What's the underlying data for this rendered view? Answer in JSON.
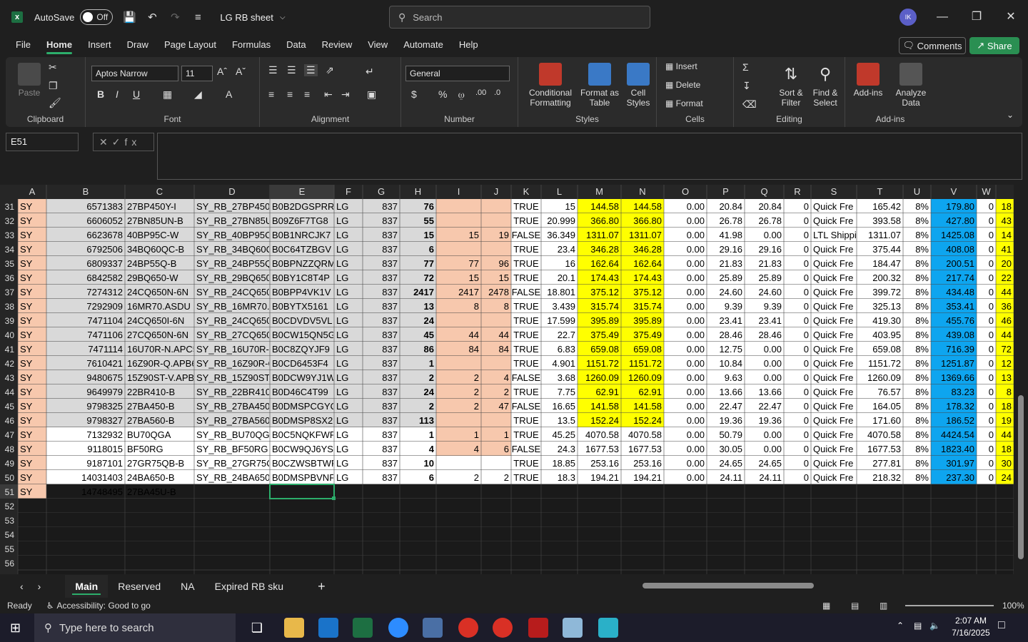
{
  "titlebar": {
    "autosave_label": "AutoSave",
    "autosave_state": "Off",
    "doc_title": "LG RB sheet",
    "search_placeholder": "Search",
    "avatar_initials": "IK"
  },
  "menu": {
    "tabs": [
      "File",
      "Home",
      "Insert",
      "Draw",
      "Page Layout",
      "Formulas",
      "Data",
      "Review",
      "View",
      "Automate",
      "Help"
    ],
    "active": "Home",
    "comments": "Comments",
    "share": "Share"
  },
  "ribbon": {
    "clipboard": {
      "paste": "Paste",
      "label": "Clipboard"
    },
    "font": {
      "name": "Aptos Narrow",
      "size": "11",
      "label": "Font"
    },
    "alignment": {
      "label": "Alignment"
    },
    "number": {
      "format": "General",
      "label": "Number"
    },
    "styles": {
      "conditional": "Conditional Formatting",
      "format_table": "Format as Table",
      "cell_styles": "Cell Styles",
      "label": "Styles"
    },
    "cells": {
      "insert": "Insert",
      "delete": "Delete",
      "format": "Format",
      "label": "Cells"
    },
    "editing": {
      "sort": "Sort & Filter",
      "find": "Find & Select",
      "label": "Editing"
    },
    "addins": {
      "addins": "Add-ins",
      "analyze": "Analyze Data",
      "label": "Add-ins"
    }
  },
  "formula_bar": {
    "name_box": "E51",
    "formula": ""
  },
  "grid": {
    "columns": [
      "A",
      "B",
      "C",
      "D",
      "E",
      "F",
      "G",
      "H",
      "I",
      "J",
      "K",
      "L",
      "M",
      "N",
      "O",
      "P",
      "Q",
      "R",
      "S",
      "T",
      "U",
      "V",
      "W"
    ],
    "rows": [
      {
        "n": "31",
        "c": [
          "SY",
          "6571383",
          "27BP450Y-I",
          "SY_RB_27BP450Y-",
          "B0B2DGSPRR",
          "LG",
          "837",
          "76",
          "",
          "",
          "TRUE",
          "15",
          "144.58",
          "144.58",
          "0.00",
          "20.84",
          "20.84",
          "0",
          "Quick Fre",
          "165.42",
          "8%",
          "179.80",
          "0",
          "18"
        ]
      },
      {
        "n": "32",
        "c": [
          "SY",
          "6606052",
          "27BN85UN-B",
          "SY_RB_27BN85UN",
          "B09Z6F7TG8",
          "LG",
          "837",
          "55",
          "",
          "",
          "TRUE",
          "20.999",
          "366.80",
          "366.80",
          "0.00",
          "26.78",
          "26.78",
          "0",
          "Quick Fre",
          "393.58",
          "8%",
          "427.80",
          "0",
          "43"
        ]
      },
      {
        "n": "33",
        "c": [
          "SY",
          "6623678",
          "40BP95C-W",
          "SY_RB_40BP95C-W",
          "B0B1NRCJK7",
          "LG",
          "837",
          "15",
          "15",
          "19",
          "FALSE",
          "36.349",
          "1311.07",
          "1311.07",
          "0.00",
          "41.98",
          "0.00",
          "0",
          "LTL Shippi",
          "1311.07",
          "8%",
          "1425.08",
          "0",
          "14"
        ]
      },
      {
        "n": "34",
        "c": [
          "SY",
          "6792506",
          "34BQ60QC-B",
          "SY_RB_34BQ60QC",
          "B0C64TZBGV",
          "LG",
          "837",
          "6",
          "",
          "",
          "TRUE",
          "23.4",
          "346.28",
          "346.28",
          "0.00",
          "29.16",
          "29.16",
          "0",
          "Quick Fre",
          "375.44",
          "8%",
          "408.08",
          "0",
          "41"
        ]
      },
      {
        "n": "35",
        "c": [
          "SY",
          "6809337",
          "24BP55Q-B",
          "SY_RB_24BP55Q-",
          "B0BPNZZQRM",
          "LG",
          "837",
          "77",
          "77",
          "96",
          "TRUE",
          "16",
          "162.64",
          "162.64",
          "0.00",
          "21.83",
          "21.83",
          "0",
          "Quick Fre",
          "184.47",
          "8%",
          "200.51",
          "0",
          "20"
        ]
      },
      {
        "n": "36",
        "c": [
          "SY",
          "6842582",
          "29BQ650-W",
          "SY_RB_29BQ650-W",
          "B0BY1C8T4P",
          "LG",
          "837",
          "72",
          "15",
          "15",
          "TRUE",
          "20.1",
          "174.43",
          "174.43",
          "0.00",
          "25.89",
          "25.89",
          "0",
          "Quick Fre",
          "200.32",
          "8%",
          "217.74",
          "0",
          "22"
        ]
      },
      {
        "n": "37",
        "c": [
          "SY",
          "7274312",
          "24CQ650N-6N",
          "SY_RB_24CQ650N",
          "B0BPP4VK1V",
          "LG",
          "837",
          "2417",
          "2417",
          "2478",
          "FALSE",
          "18.801",
          "375.12",
          "375.12",
          "0.00",
          "24.60",
          "24.60",
          "0",
          "Quick Fre",
          "399.72",
          "8%",
          "434.48",
          "0",
          "44"
        ]
      },
      {
        "n": "38",
        "c": [
          "SY",
          "7292909",
          "16MR70.ASDU",
          "SY_RB_16MR70.A",
          "B0BYTX5161",
          "LG",
          "837",
          "13",
          "8",
          "8",
          "TRUE",
          "3.439",
          "315.74",
          "315.74",
          "0.00",
          "9.39",
          "9.39",
          "0",
          "Quick Fre",
          "325.13",
          "8%",
          "353.41",
          "0",
          "36"
        ]
      },
      {
        "n": "39",
        "c": [
          "SY",
          "7471104",
          "24CQ650I-6N",
          "SY_RB_24CQ650I-",
          "B0CDVDV5VL",
          "LG",
          "837",
          "24",
          "",
          "",
          "TRUE",
          "17.599",
          "395.89",
          "395.89",
          "0.00",
          "23.41",
          "23.41",
          "0",
          "Quick Fre",
          "419.30",
          "8%",
          "455.76",
          "0",
          "46"
        ]
      },
      {
        "n": "40",
        "c": [
          "SY",
          "7471106",
          "27CQ650N-6N",
          "SY_RB_27CQ650N",
          "B0CW15QN5G",
          "LG",
          "837",
          "45",
          "44",
          "44",
          "TRUE",
          "22.7",
          "375.49",
          "375.49",
          "0.00",
          "28.46",
          "28.46",
          "0",
          "Quick Fre",
          "403.95",
          "8%",
          "439.08",
          "0",
          "44"
        ]
      },
      {
        "n": "41",
        "c": [
          "SY",
          "7471114",
          "16U70R-N.APC5",
          "SY_RB_16U70R-N",
          "B0C8ZQYJF9",
          "LG",
          "837",
          "86",
          "84",
          "84",
          "TRUE",
          "6.83",
          "659.08",
          "659.08",
          "0.00",
          "12.75",
          "0.00",
          "0",
          "Quick Fre",
          "659.08",
          "8%",
          "716.39",
          "0",
          "72"
        ]
      },
      {
        "n": "42",
        "c": [
          "SY",
          "7610421",
          "16Z90R-Q.APB6",
          "SY_RB_16Z90R-Q",
          "B0CD6453F4",
          "LG",
          "837",
          "1",
          "",
          "",
          "TRUE",
          "4.901",
          "1151.72",
          "1151.72",
          "0.00",
          "10.84",
          "0.00",
          "0",
          "Quick Fre",
          "1151.72",
          "8%",
          "1251.87",
          "0",
          "12"
        ]
      },
      {
        "n": "43",
        "c": [
          "SY",
          "9480675",
          "15Z90ST-V.APB6",
          "SY_RB_15Z90ST-V",
          "B0DCW9YJ1W",
          "LG",
          "837",
          "2",
          "2",
          "4",
          "FALSE",
          "3.68",
          "1260.09",
          "1260.09",
          "0.00",
          "9.63",
          "0.00",
          "0",
          "Quick Fre",
          "1260.09",
          "8%",
          "1369.66",
          "0",
          "13"
        ]
      },
      {
        "n": "44",
        "c": [
          "SY",
          "9649979",
          "22BR410-B",
          "SY_RB_22BR410-B",
          "B0D46C4T99",
          "LG",
          "837",
          "24",
          "2",
          "2",
          "TRUE",
          "7.75",
          "62.91",
          "62.91",
          "0.00",
          "13.66",
          "13.66",
          "0",
          "Quick Fre",
          "76.57",
          "8%",
          "83.23",
          "0",
          "8"
        ]
      },
      {
        "n": "45",
        "c": [
          "SY",
          "9798325",
          "27BA450-B",
          "SY_RB_27BA450-B",
          "B0DMSPCGYQ",
          "LG",
          "837",
          "2",
          "2",
          "47",
          "FALSE",
          "16.65",
          "141.58",
          "141.58",
          "0.00",
          "22.47",
          "22.47",
          "0",
          "Quick Fre",
          "164.05",
          "8%",
          "178.32",
          "0",
          "18"
        ]
      },
      {
        "n": "46",
        "c": [
          "SY",
          "9798327",
          "27BA560-B",
          "SY_RB_27BA560-B",
          "B0DMSP8SX2",
          "LG",
          "837",
          "113",
          "",
          "",
          "TRUE",
          "13.5",
          "152.24",
          "152.24",
          "0.00",
          "19.36",
          "19.36",
          "0",
          "Quick Fre",
          "171.60",
          "8%",
          "186.52",
          "0",
          "19"
        ]
      },
      {
        "n": "47",
        "c": [
          "SY",
          "7132932",
          "BU70QGA",
          "SY_RB_BU70QGA",
          "B0C5NQKFWP",
          "LG",
          "837",
          "1",
          "1",
          "1",
          "TRUE",
          "45.25",
          "4070.58",
          "4070.58",
          "0.00",
          "50.79",
          "0.00",
          "0",
          "Quick Fre",
          "4070.58",
          "8%",
          "4424.54",
          "0",
          "44"
        ]
      },
      {
        "n": "48",
        "c": [
          "SY",
          "9118015",
          "BF50RG",
          "SY_RB_BF50RG",
          "B0CW9QJ6YS",
          "LG",
          "837",
          "4",
          "4",
          "6",
          "FALSE",
          "24.3",
          "1677.53",
          "1677.53",
          "0.00",
          "30.05",
          "0.00",
          "0",
          "Quick Fre",
          "1677.53",
          "8%",
          "1823.40",
          "0",
          "18"
        ]
      },
      {
        "n": "49",
        "c": [
          "SY",
          "9187101",
          "27GR75QB-B",
          "SY_RB_27GR75QB",
          "B0CZWSBTWR",
          "LG",
          "837",
          "10",
          "",
          "",
          "TRUE",
          "18.85",
          "253.16",
          "253.16",
          "0.00",
          "24.65",
          "24.65",
          "0",
          "Quick Fre",
          "277.81",
          "8%",
          "301.97",
          "0",
          "30"
        ]
      },
      {
        "n": "50",
        "c": [
          "SY",
          "14031403",
          "24BA650-B",
          "SY_RB_24BA650-B",
          "B0DMSPBVNF",
          "LG",
          "837",
          "6",
          "2",
          "2",
          "TRUE",
          "18.3",
          "194.21",
          "194.21",
          "0.00",
          "24.11",
          "24.11",
          "0",
          "Quick Fre",
          "218.32",
          "8%",
          "237.30",
          "0",
          "24"
        ]
      },
      {
        "n": "51",
        "c": [
          "SY",
          "14748495",
          "27BA45U-B",
          "",
          "",
          "",
          "",
          "",
          "",
          "",
          "",
          "",
          "",
          "",
          "",
          "",
          "",
          "",
          "",
          "",
          "",
          "",
          "",
          ""
        ]
      },
      {
        "n": "52",
        "c": []
      },
      {
        "n": "53",
        "c": []
      },
      {
        "n": "54",
        "c": []
      },
      {
        "n": "55",
        "c": []
      },
      {
        "n": "56",
        "c": []
      }
    ]
  },
  "sheets": {
    "tabs": [
      "Main",
      "Reserved",
      "NA",
      "Expired RB sku"
    ],
    "active": "Main"
  },
  "status": {
    "ready": "Ready",
    "accessibility": "Accessibility: Good to go",
    "zoom": "100%"
  },
  "taskbar": {
    "search_placeholder": "Type here to search",
    "time": "2:07 AM",
    "date": "7/16/2025"
  },
  "colors": {
    "salmon": "#f7c8ad",
    "yellow": "#ffff00",
    "blue": "#0ea5ef",
    "gray": "#d9d9d9",
    "white": "#ffffff",
    "accent": "#2cae6b"
  }
}
